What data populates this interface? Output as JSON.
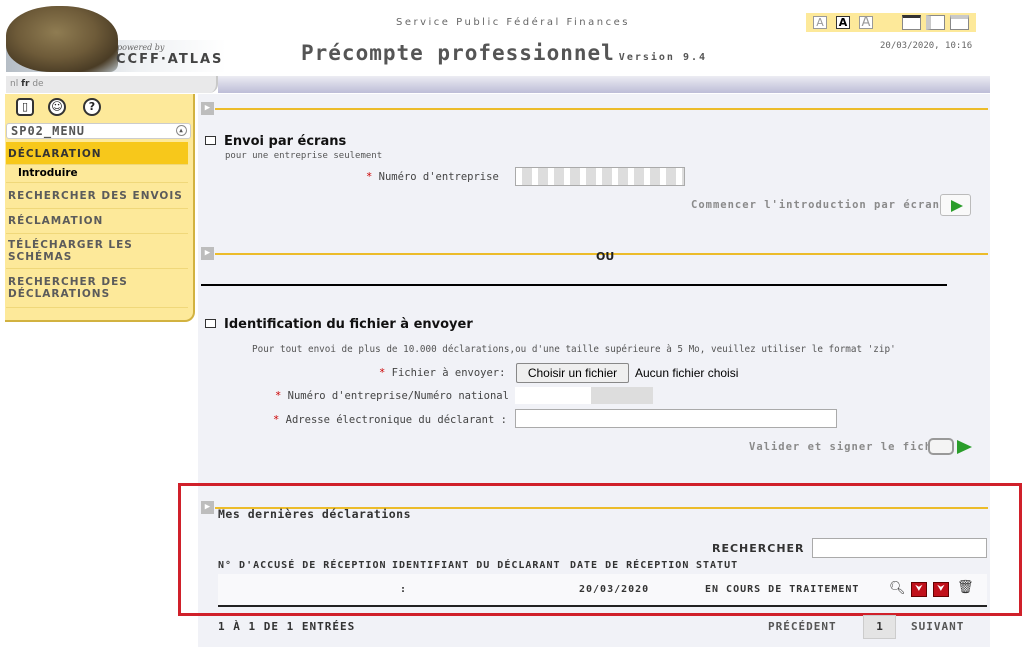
{
  "header": {
    "powered_by": "powered by",
    "brand": "CCFF·ATLAS",
    "service": "Service Public Fédéral Finances",
    "title": "Précompte professionnel",
    "version": "Version 9.4",
    "datetime": "20/03/2020, 10:16",
    "text_size_buttons": [
      "A",
      "A",
      "A"
    ]
  },
  "languages": {
    "nl": "nl",
    "fr": "fr",
    "de": "de",
    "current": "fr"
  },
  "sidebar": {
    "menu_title": "SP02_MENU",
    "icons": [
      "exit-icon",
      "user-icon",
      "help-icon"
    ],
    "items": [
      {
        "label": "DÉCLARATION",
        "active": true
      },
      {
        "label": "Introduire"
      },
      {
        "label": "RECHERCHER DES ENVOIS"
      },
      {
        "label": "RÉCLAMATION"
      },
      {
        "label": "TÉLÉCHARGER LES SCHÉMAS"
      },
      {
        "label": "RECHERCHER DES DÉCLARATIONS"
      }
    ]
  },
  "screen_entry": {
    "title": "Envoi par écrans",
    "subtitle": "pour une entreprise seulement",
    "company_number_label": "Numéro d'entreprise",
    "start_button_label": "Commencer l'introduction par écrans"
  },
  "separator": {
    "label": "OU"
  },
  "file_upload": {
    "title": "Identification du fichier à envoyer",
    "notice": "Pour tout envoi de plus de 10.000 déclarations,ou d'une taille supérieure à 5 Mo, veuillez utiliser le format 'zip'",
    "file_label": "Fichier à envoyer:",
    "choose_button": "Choisir un fichier",
    "no_file": "Aucun fichier choisi",
    "national_number_label": "Numéro d'entreprise/Numéro national",
    "email_label": "Adresse électronique du déclarant :",
    "validate_label": "Valider et signer le fichier"
  },
  "declarations": {
    "title": "Mes dernières déclarations",
    "search_label": "RECHERCHER",
    "columns": [
      "N° D'ACCUSÉ DE RÉCEPTION",
      "IDENTIFIANT DU DÉCLARANT",
      "DATE DE RÉCEPTION",
      "STATUT"
    ],
    "rows": [
      {
        "receipt_no": "",
        "declarant_id": ":",
        "date": "20/03/2020",
        "status": "EN COURS DE TRAITEMENT"
      }
    ],
    "entries_info": "1 À 1 DE 1 ENTRÉES",
    "pagination": {
      "prev": "PRÉCÉDENT",
      "page": "1",
      "next": "SUIVANT"
    }
  },
  "colors": {
    "accent_yellow": "#f7c81b",
    "panel_yellow": "#fde99a",
    "highlight_red": "#d0202a",
    "play_green": "#2a9d2a"
  }
}
